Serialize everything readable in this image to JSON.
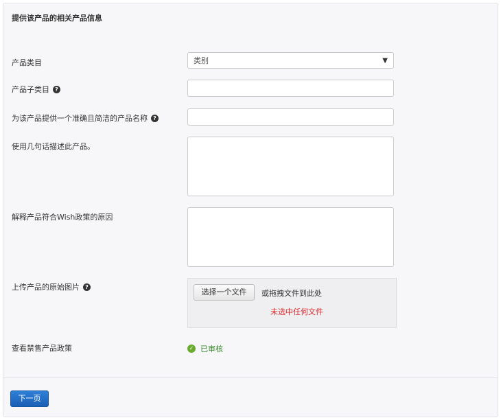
{
  "form": {
    "title": "提供该产品的相关产品信息",
    "category": {
      "label": "产品类目",
      "value": "类别"
    },
    "subcategory": {
      "label": "产品子类目",
      "value": ""
    },
    "name": {
      "label": "为该产品提供一个准确且简洁的产品名称",
      "value": ""
    },
    "description": {
      "label": "使用几句话描述此产品。",
      "value": ""
    },
    "reason": {
      "label": "解释产品符合Wish政策的原因",
      "value": ""
    },
    "upload": {
      "label": "上传产品的原始图片",
      "choose_label": "选择一个文件",
      "drag_text": "或拖拽文件到此处",
      "status": "未选中任何文件"
    },
    "policy": {
      "label": "查看禁售产品政策",
      "status": "已审核"
    },
    "next_label": "下一页"
  }
}
